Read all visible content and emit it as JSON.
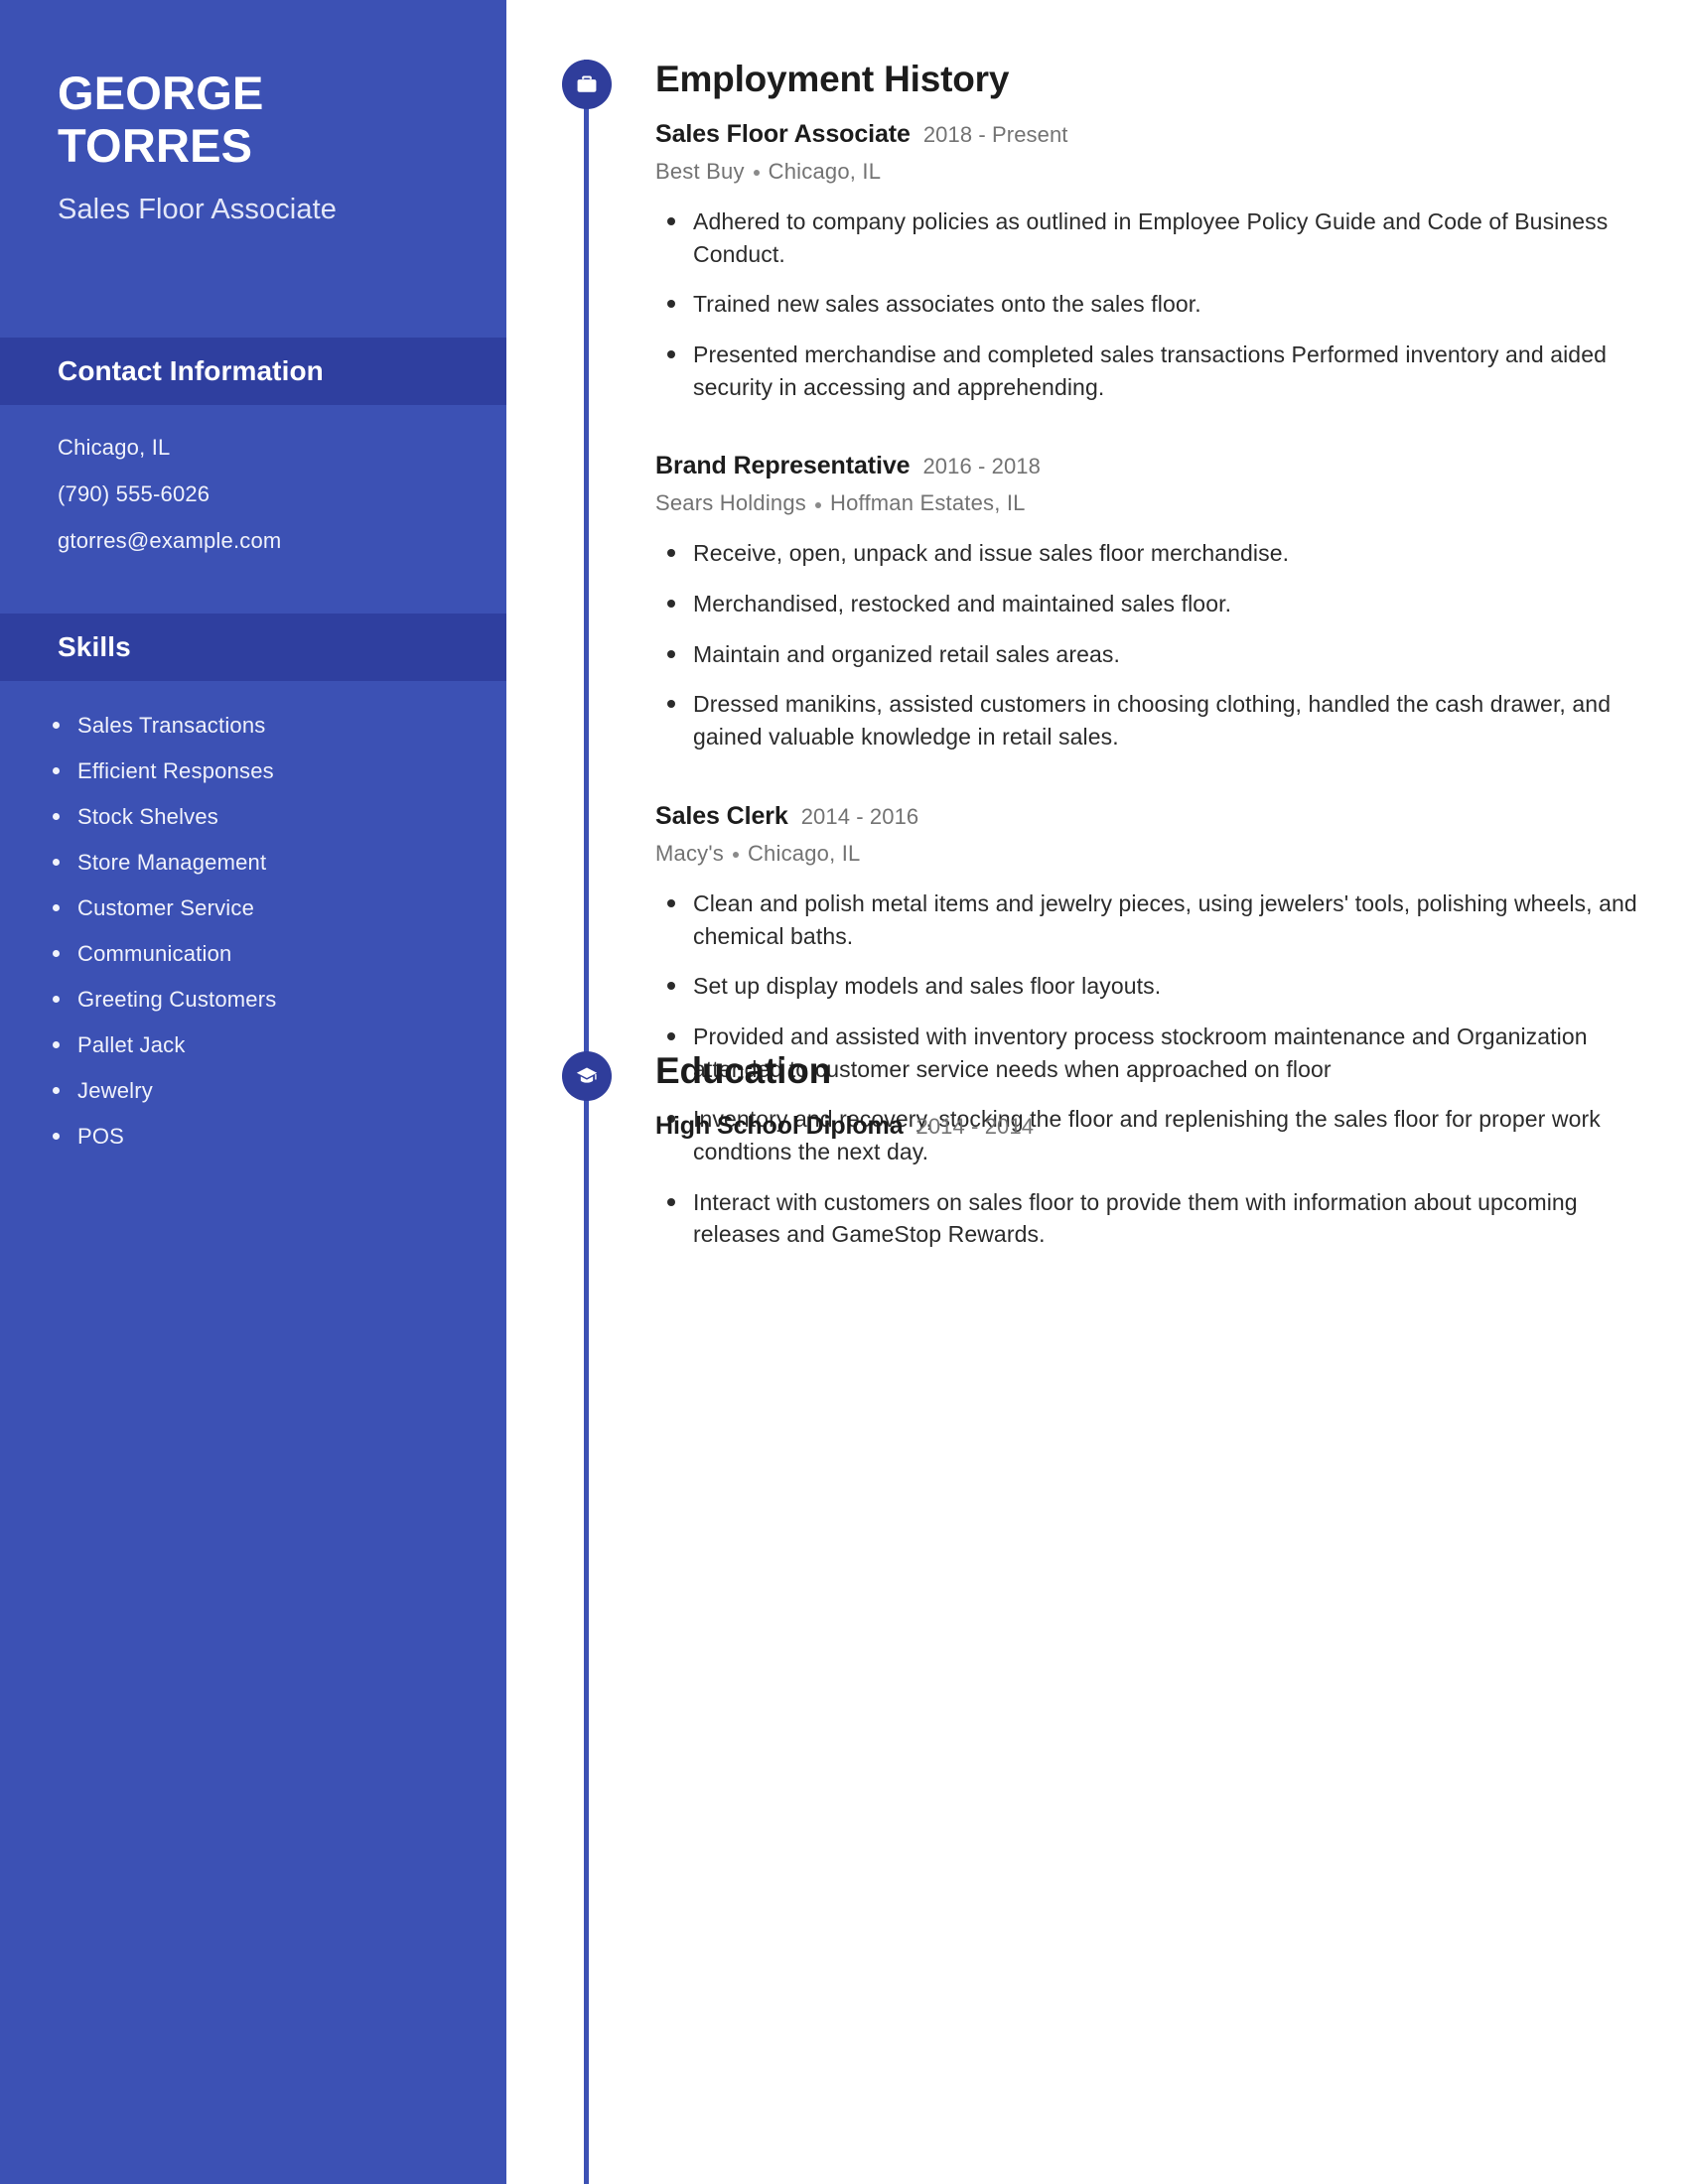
{
  "document_type": "resume",
  "theme": {
    "sidebar_bg": "#3c51b4",
    "sidebar_header_bg": "#2f3f9f",
    "accent": "#2f3d9b",
    "timeline_color": "#3c51b4",
    "body_text": "#2b2b2b",
    "muted_text": "#737373",
    "page_bg": "#ffffff"
  },
  "sidebar": {
    "name": "GEORGE TORRES",
    "job_title": "Sales Floor Associate",
    "contact": {
      "heading": "Contact Information",
      "lines": [
        "Chicago, IL",
        "(790) 555-6026",
        "gtorres@example.com"
      ]
    },
    "skills": {
      "heading": "Skills",
      "items": [
        "Sales Transactions",
        "Efficient Responses",
        "Stock Shelves",
        "Store Management",
        "Customer Service",
        "Communication",
        "Greeting Customers",
        "Pallet Jack",
        "Jewelry",
        "POS"
      ]
    }
  },
  "main": {
    "employment": {
      "heading": "Employment History",
      "icon": "briefcase-icon",
      "entries": [
        {
          "role": "Sales Floor Associate",
          "dates": "2018 - Present",
          "company": "Best Buy",
          "location": "Chicago, IL",
          "bullets": [
            "Adhered to company policies as outlined in Employee Policy Guide and Code of Business Conduct.",
            "Trained new sales associates onto the sales floor.",
            "Presented merchandise and completed sales transactions Performed inventory and aided security in accessing and apprehending."
          ]
        },
        {
          "role": "Brand Representative",
          "dates": "2016 - 2018",
          "company": "Sears Holdings",
          "location": "Hoffman Estates, IL",
          "bullets": [
            "Receive, open, unpack and issue sales floor merchandise.",
            "Merchandised, restocked and maintained sales floor.",
            "Maintain and organized retail sales areas.",
            "Dressed manikins, assisted customers in choosing clothing, handled the cash drawer, and gained valuable knowledge in retail sales."
          ]
        },
        {
          "role": "Sales Clerk",
          "dates": "2014 - 2016",
          "company": "Macy's",
          "location": "Chicago, IL",
          "bullets": [
            "Clean and polish metal items and jewelry pieces, using jewelers' tools, polishing wheels, and chemical baths.",
            "Set up display models and sales floor layouts.",
            "Provided and assisted with inventory process stockroom maintenance and Organization attended to customer service needs when approached on floor",
            "Inventory and recovery, stocking the floor and replenishing the sales floor for proper work condtions the next day.",
            "Interact with customers on sales floor to provide them with information about upcoming releases and GameStop Rewards."
          ]
        }
      ]
    },
    "education": {
      "heading": "Education",
      "icon": "graduation-cap-icon",
      "entries": [
        {
          "degree": "High School Diploma",
          "dates": "2014 - 2014"
        }
      ]
    }
  }
}
